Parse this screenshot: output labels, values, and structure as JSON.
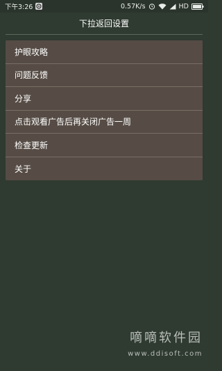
{
  "status_bar": {
    "time": "下午3:26",
    "network_speed": "0.57K/s",
    "network_type": "HD",
    "icons": [
      "app-notification-icon",
      "alarm-icon",
      "wifi-icon",
      "signal-icon",
      "battery-icon"
    ]
  },
  "header": {
    "title": "下拉返回设置"
  },
  "menu": {
    "items": [
      {
        "label": "护眼攻略"
      },
      {
        "label": "问题反馈"
      },
      {
        "label": "分享"
      },
      {
        "label": "点击观看广告后再关闭广告一周"
      },
      {
        "label": "检查更新"
      },
      {
        "label": "关于"
      }
    ]
  },
  "watermark": {
    "title": "嘀嘀软件园",
    "url": "www.ddisoft.com"
  },
  "colors": {
    "background": "#2f3a31",
    "card": "#564c45",
    "divider": "#7a6f67",
    "text": "#ffffff"
  }
}
